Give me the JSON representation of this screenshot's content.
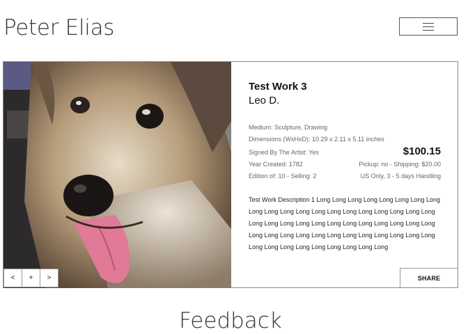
{
  "header": {
    "site_title": "Peter Elias",
    "menu_icon": "hamburger-icon"
  },
  "artwork": {
    "title": "Test Work 3",
    "artist": "Leo D.",
    "medium": "Medium: Sculpture, Drawing",
    "dimensions": "Dimensions (WxHxD): 10.29 x 2.11 x 5.11 inches",
    "signed": "Signed By The Artist: Yes",
    "price": "$100.15",
    "year": "Year Created: 1782",
    "shipping": "Pickup: no - Shipping: $20.00",
    "edition": "Edition of: 10 - Selling: 2",
    "handling": "US Only, 3 - 5 days Handling",
    "description": "Test Work Description 1 Long Long Long Long Long Long Long Long Long Long Long Long Long Long Long Long Long Long Long Long Long Long Long Long Long Long Long Long Long Long Long Long Long Long Long Long Long Long Long Long Long Long Long Long Long Long Long Long Long Long Long Long Long"
  },
  "gallery": {
    "prev_label": "<",
    "add_label": "+",
    "next_label": ">"
  },
  "actions": {
    "share_label": "SHARE"
  },
  "footer": {
    "feedback_heading": "Feedback"
  }
}
